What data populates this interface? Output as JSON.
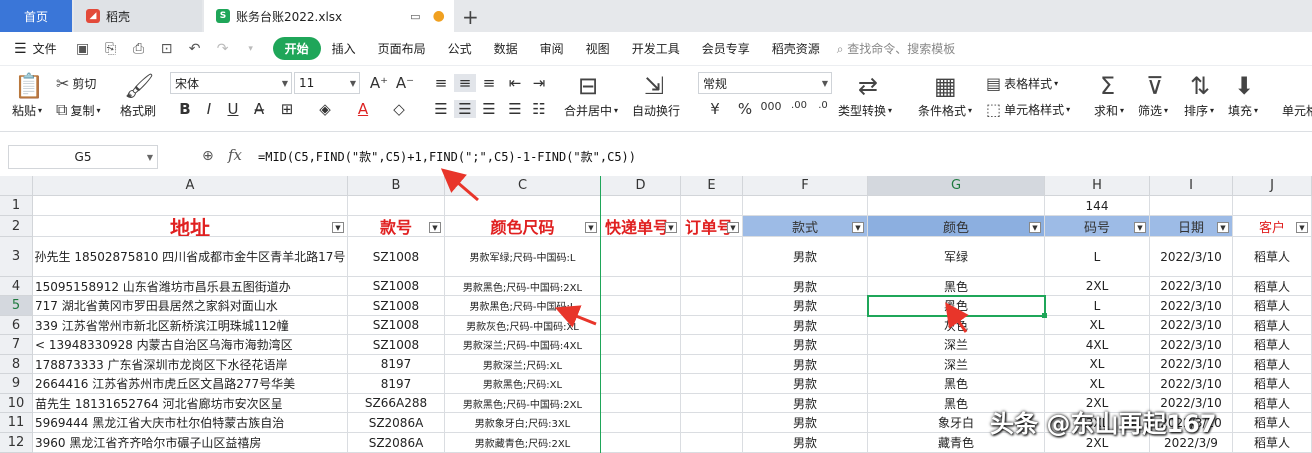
{
  "tabs": {
    "home": "首页",
    "daoke": "稻壳",
    "file": "账务台账2022.xlsx"
  },
  "menu": {
    "file": "文件",
    "tabs": [
      "开始",
      "插入",
      "页面布局",
      "公式",
      "数据",
      "审阅",
      "视图",
      "开发工具",
      "会员专享",
      "稻壳资源"
    ],
    "search": "查找命令、搜索模板"
  },
  "ribbon": {
    "paste": "粘贴",
    "cut": "剪切",
    "copy": "复制",
    "format_painter": "格式刷",
    "font_name": "宋体",
    "font_size": "11",
    "merge_center": "合并居中",
    "wrap_text": "自动换行",
    "number_format": "常规",
    "type_convert": "类型转换",
    "conditional_format": "条件格式",
    "table_style": "表格样式",
    "cell_style": "单元格样式",
    "sum": "求和",
    "filter": "筛选",
    "sort": "排序",
    "fill": "填充",
    "cell": "单元格"
  },
  "formula_bar": {
    "name_box": "G5",
    "fx": "fx",
    "formula": "=MID(C5,FIND(\"款\",C5)+1,FIND(\";\",C5)-1-FIND(\"款\",C5))"
  },
  "columns": [
    "A",
    "B",
    "C",
    "D",
    "E",
    "F",
    "G",
    "H",
    "I",
    "J"
  ],
  "rows": [
    "1",
    "2",
    "3",
    "4",
    "5",
    "6",
    "7",
    "8",
    "9",
    "10",
    "11",
    "12"
  ],
  "row1": {
    "H": "144"
  },
  "headers": {
    "A": "地址",
    "B": "款号",
    "C": "颜色尺码",
    "D": "快递单号",
    "E": "订单号",
    "F": "款式",
    "G": "颜色",
    "H": "码号",
    "I": "日期",
    "J": "客户"
  },
  "data": [
    {
      "A": "孙先生 18502875810  四川省成都市金牛区青羊北路17号",
      "B": "SZ1008",
      "C": "男款军绿;尺码-中国码:L",
      "F": "男款",
      "G": "军绿",
      "H": "L",
      "I": "2022/3/10",
      "J": "稻草人"
    },
    {
      "A": "15095158912   山东省潍坊市昌乐县五图街道办",
      "B": "SZ1008",
      "C": "男款黑色;尺码-中国码:2XL",
      "F": "男款",
      "G": "黑色",
      "H": "2XL",
      "I": "2022/3/10",
      "J": "稻草人"
    },
    {
      "A": "717   湖北省黄冈市罗田县居然之家斜对面山水",
      "B": "SZ1008",
      "C": "男款黑色;尺码-中国码:L",
      "F": "男款",
      "G": "黑色",
      "H": "L",
      "I": "2022/3/10",
      "J": "稻草人"
    },
    {
      "A": "339   江苏省常州市新北区新桥滨江明珠城112幢",
      "B": "SZ1008",
      "C": "男款灰色;尺码-中国码:XL",
      "F": "男款",
      "G": "灰色",
      "H": "XL",
      "I": "2022/3/10",
      "J": "稻草人"
    },
    {
      "A": "< 13948330928   内蒙古自治区乌海市海勃湾区",
      "B": "SZ1008",
      "C": "男款深兰;尺码-中国码:4XL",
      "F": "男款",
      "G": "深兰",
      "H": "4XL",
      "I": "2022/3/10",
      "J": "稻草人"
    },
    {
      "A": "178873333   广东省深圳市龙岗区下水径花语岸",
      "B": "8197",
      "C": "男款深兰;尺码:XL",
      "F": "男款",
      "G": "深兰",
      "H": "XL",
      "I": "2022/3/10",
      "J": "稻草人"
    },
    {
      "A": "2664416   江苏省苏州市虎丘区文昌路277号华美",
      "B": "8197",
      "C": "男款黑色;尺码:XL",
      "F": "男款",
      "G": "黑色",
      "H": "XL",
      "I": "2022/3/10",
      "J": "稻草人"
    },
    {
      "A": "苗先生 18131652764   河北省廊坊市安次区呈",
      "B": "SZ66A288",
      "C": "男款黑色;尺码-中国码:2XL",
      "F": "男款",
      "G": "黑色",
      "H": "2XL",
      "I": "2022/3/10",
      "J": "稻草人"
    },
    {
      "A": "5969444   黑龙江省大庆市杜尔伯特蒙古族自治",
      "B": "SZ2086A",
      "C": "男款象牙白;尺码:3XL",
      "F": "男款",
      "G": "象牙白",
      "H": "3XL",
      "I": "2022/3/10",
      "J": "稻草人"
    },
    {
      "A": "3960   黑龙江省齐齐哈尔市碾子山区益禧房",
      "B": "SZ2086A",
      "C": "男款藏青色;尺码:2XL",
      "F": "男款",
      "G": "藏青色",
      "H": "2XL",
      "I": "2022/3/9",
      "J": "稻草人"
    }
  ],
  "watermark": "头条 @东山再起167",
  "colors": {
    "accent_green": "#1fa659",
    "header_red": "#e02020",
    "header_blue": "#9dbbe6",
    "home_tab": "#3a76d8",
    "arrow_red": "#e8352a"
  }
}
